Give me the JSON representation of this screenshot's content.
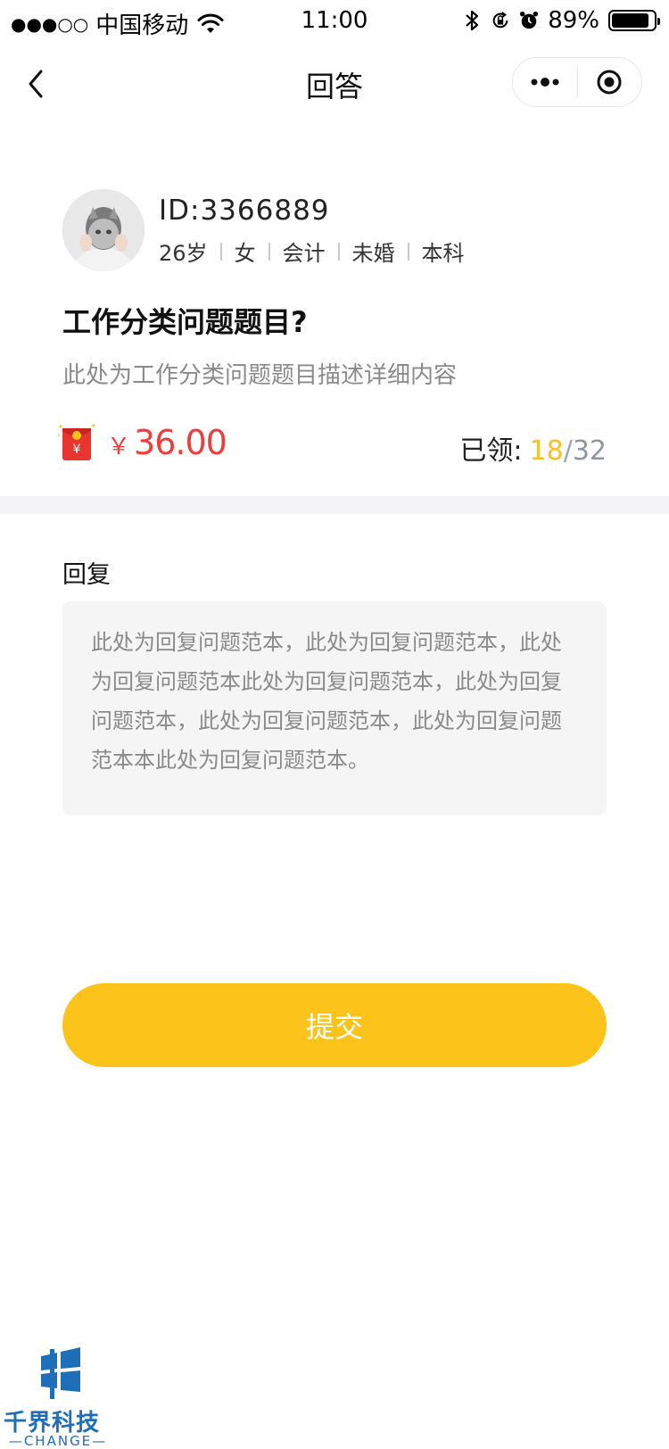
{
  "status_bar": {
    "signal": "●●●○○",
    "carrier": "中国移动",
    "time": "11:00",
    "battery_percent": "89%",
    "battery_level": 0.89
  },
  "nav": {
    "title": "回答"
  },
  "user": {
    "id_text": "ID:3366889",
    "tags": [
      "26岁",
      "女",
      "会计",
      "未婚",
      "本科"
    ]
  },
  "question": {
    "title": "工作分类问题题目?",
    "description": "此处为工作分类问题题目描述详细内容"
  },
  "reward": {
    "currency_symbol": "￥",
    "amount": "36.00",
    "claimed_label": "已领:",
    "claimed_count": "18",
    "separator": "/",
    "total": "32",
    "colors": {
      "amount": "#f03c3c",
      "count": "#fbbf23"
    }
  },
  "reply": {
    "label": "回复",
    "content": "此处为回复问题范本，此处为回复问题范本，此处为回复问题范本此处为回复问题范本，此处为回复问题范本，此处为回复问题范本，此处为回复问题范本本此处为回复问题范本。"
  },
  "submit": {
    "label": "提交",
    "color": "#fcc41b"
  },
  "watermark": {
    "name": "千界科技",
    "sub": "CHANGE"
  },
  "icons": [
    "wifi-icon",
    "bluetooth-icon",
    "rotation-lock-icon",
    "alarm-icon",
    "battery-icon",
    "back-arrow-icon",
    "more-icon",
    "close-circle-icon",
    "red-packet-icon"
  ]
}
